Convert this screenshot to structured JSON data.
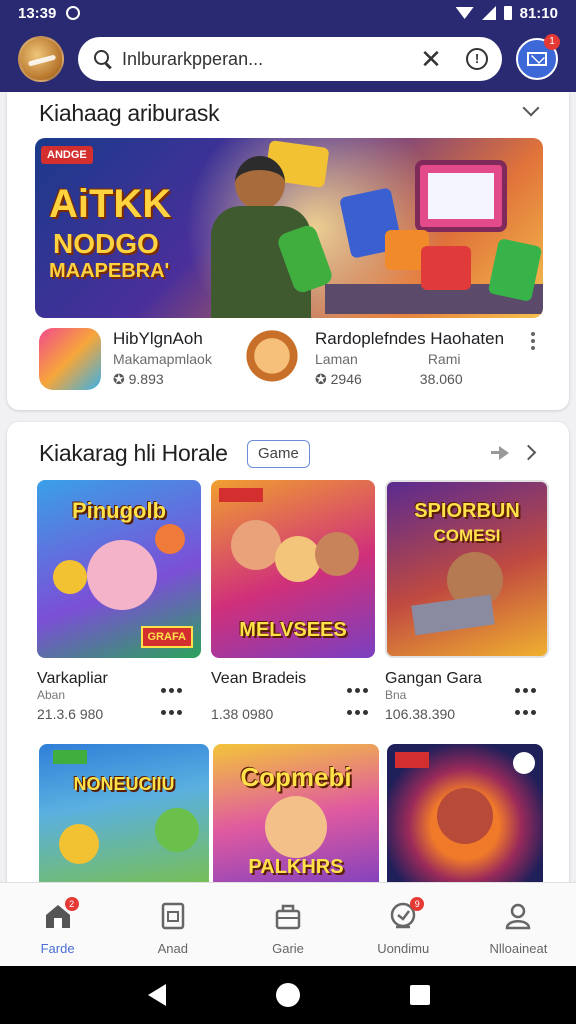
{
  "status_bar": {
    "time": "13:39",
    "right_text": "81:10"
  },
  "search": {
    "placeholder": "Inlburarkpperan...",
    "mail_badge": "1"
  },
  "section1": {
    "title": "Kiahaag ariburask",
    "banner": {
      "tag": "ANDGE",
      "line1": "AiTKK",
      "line2": "NODGO",
      "line3": "MAAPEBRA'"
    },
    "items": [
      {
        "name": "HibYlgnAoh",
        "sub": "Makamapmlaok",
        "rating": "9.893",
        "icon": "app-icon-doors"
      },
      {
        "name": "Rardoplefndes Haohaten",
        "sub": "Laman",
        "rating": "2946",
        "right_value": "38.060",
        "right_sub": "Rami",
        "icon": "app-icon-face"
      }
    ]
  },
  "section2": {
    "title": "Kiakarag hli Horale",
    "chip": "Game",
    "games": [
      {
        "tile_title": "Pinugolb",
        "tile_sub": "GRAFA",
        "name": "Varkapliar",
        "sub": "Aban",
        "value": "21.3.6 980",
        "colors": [
          "#3aa0e8",
          "#7b4fd6"
        ]
      },
      {
        "tile_title": "",
        "tile_sub": "MELVSEES",
        "name": "Vean Bradeis",
        "sub": "",
        "value": "1.38 0980",
        "colors": [
          "#f0a030",
          "#d0307a"
        ]
      },
      {
        "tile_title": "SPIORBUN",
        "tile_sub": "COMESI",
        "name": "Gangan Gara",
        "sub": "Bna",
        "value": "106.38.390",
        "colors": [
          "#5a2a90",
          "#f0b030"
        ]
      }
    ],
    "more_games": [
      {
        "tile_title": "NONEUCIIU",
        "tile_sub": "",
        "colors": [
          "#2f7fd8",
          "#7ac04a"
        ]
      },
      {
        "tile_title": "Copmebi",
        "tile_sub": "PALKHRS",
        "colors": [
          "#f3c43a",
          "#c03fb0"
        ]
      },
      {
        "tile_title": "",
        "tile_sub": "",
        "colors": [
          "#1f1f5a",
          "#d94a2a"
        ]
      }
    ]
  },
  "bottom_nav": [
    {
      "label": "Farde",
      "icon": "home-icon",
      "badge": "2",
      "active": true
    },
    {
      "label": "Anad",
      "icon": "apps-icon",
      "badge": "",
      "active": false
    },
    {
      "label": "Garie",
      "icon": "games-icon",
      "badge": "",
      "active": false
    },
    {
      "label": "Uondimu",
      "icon": "updates-icon",
      "badge": "9",
      "active": false
    },
    {
      "label": "Nlloaineat",
      "icon": "account-icon",
      "badge": "",
      "active": false
    }
  ],
  "colors": {
    "bar": "#2a2a72",
    "accent": "#4a6ed6",
    "badge": "#e53935"
  }
}
